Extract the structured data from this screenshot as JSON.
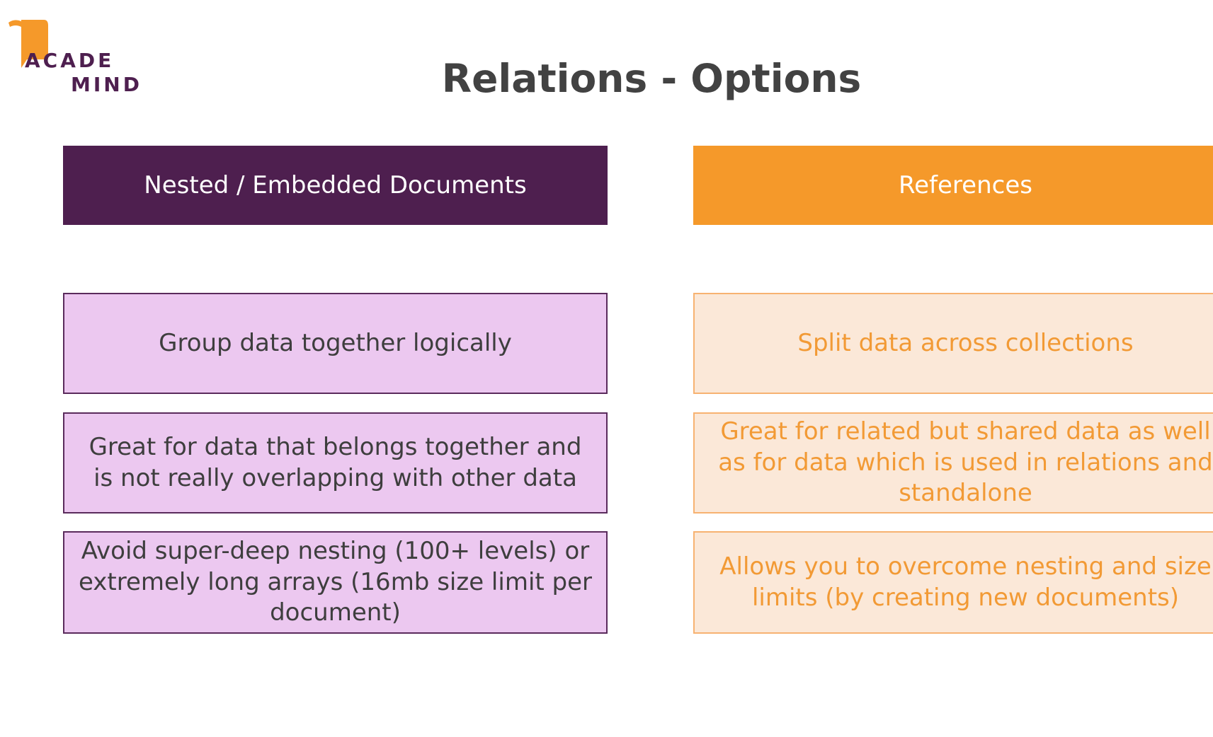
{
  "logo": {
    "line1": "ACADE",
    "line2": "MIND"
  },
  "title": "Relations - Options",
  "colors": {
    "purple": "#4e1f4f",
    "orange": "#f5992a",
    "purple_light": "#ecc8f0",
    "orange_light": "#fbe8d8"
  },
  "left": {
    "header": "Nested / Embedded Documents",
    "cards": [
      "Group data together logically",
      "Great for data that belongs together and is not really overlapping with other data",
      "Avoid super-deep nesting (100+ levels) or extremely long arrays (16mb size limit per document)"
    ]
  },
  "right": {
    "header": "References",
    "cards": [
      "Split data across collections",
      "Great for related but shared data as well as for data which is used in relations and standalone",
      "Allows you to overcome nesting and size limits (by creating new documents)"
    ]
  }
}
